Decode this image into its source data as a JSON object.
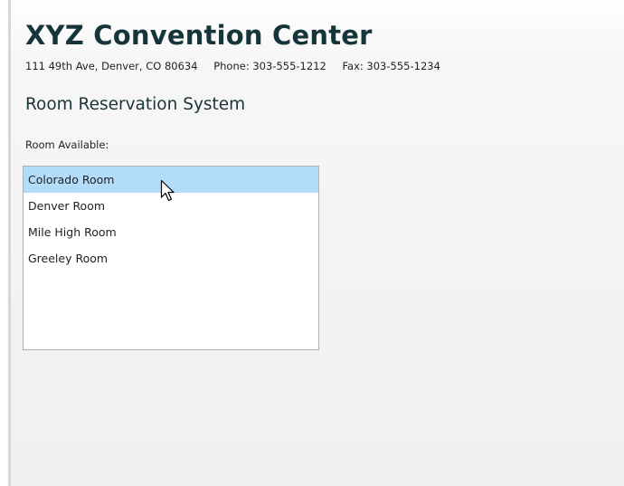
{
  "header": {
    "title": "XYZ Convention Center",
    "address": "111 49th Ave, Denver, CO 80634",
    "phone": "Phone: 303-555-1212",
    "fax": "Fax: 303-555-1234"
  },
  "reservation": {
    "heading": "Room Reservation System",
    "rooms_label": "Room Available:",
    "rooms": [
      "Colorado Room",
      "Denver Room",
      "Mile High Room",
      "Greeley Room"
    ],
    "selected_room": "Colorado Room"
  },
  "colors": {
    "title": "#16353a",
    "selection": "#b3dcfb",
    "list_border": "#aab3bd"
  },
  "icons": {
    "cursor": "mouse-pointer-icon"
  }
}
